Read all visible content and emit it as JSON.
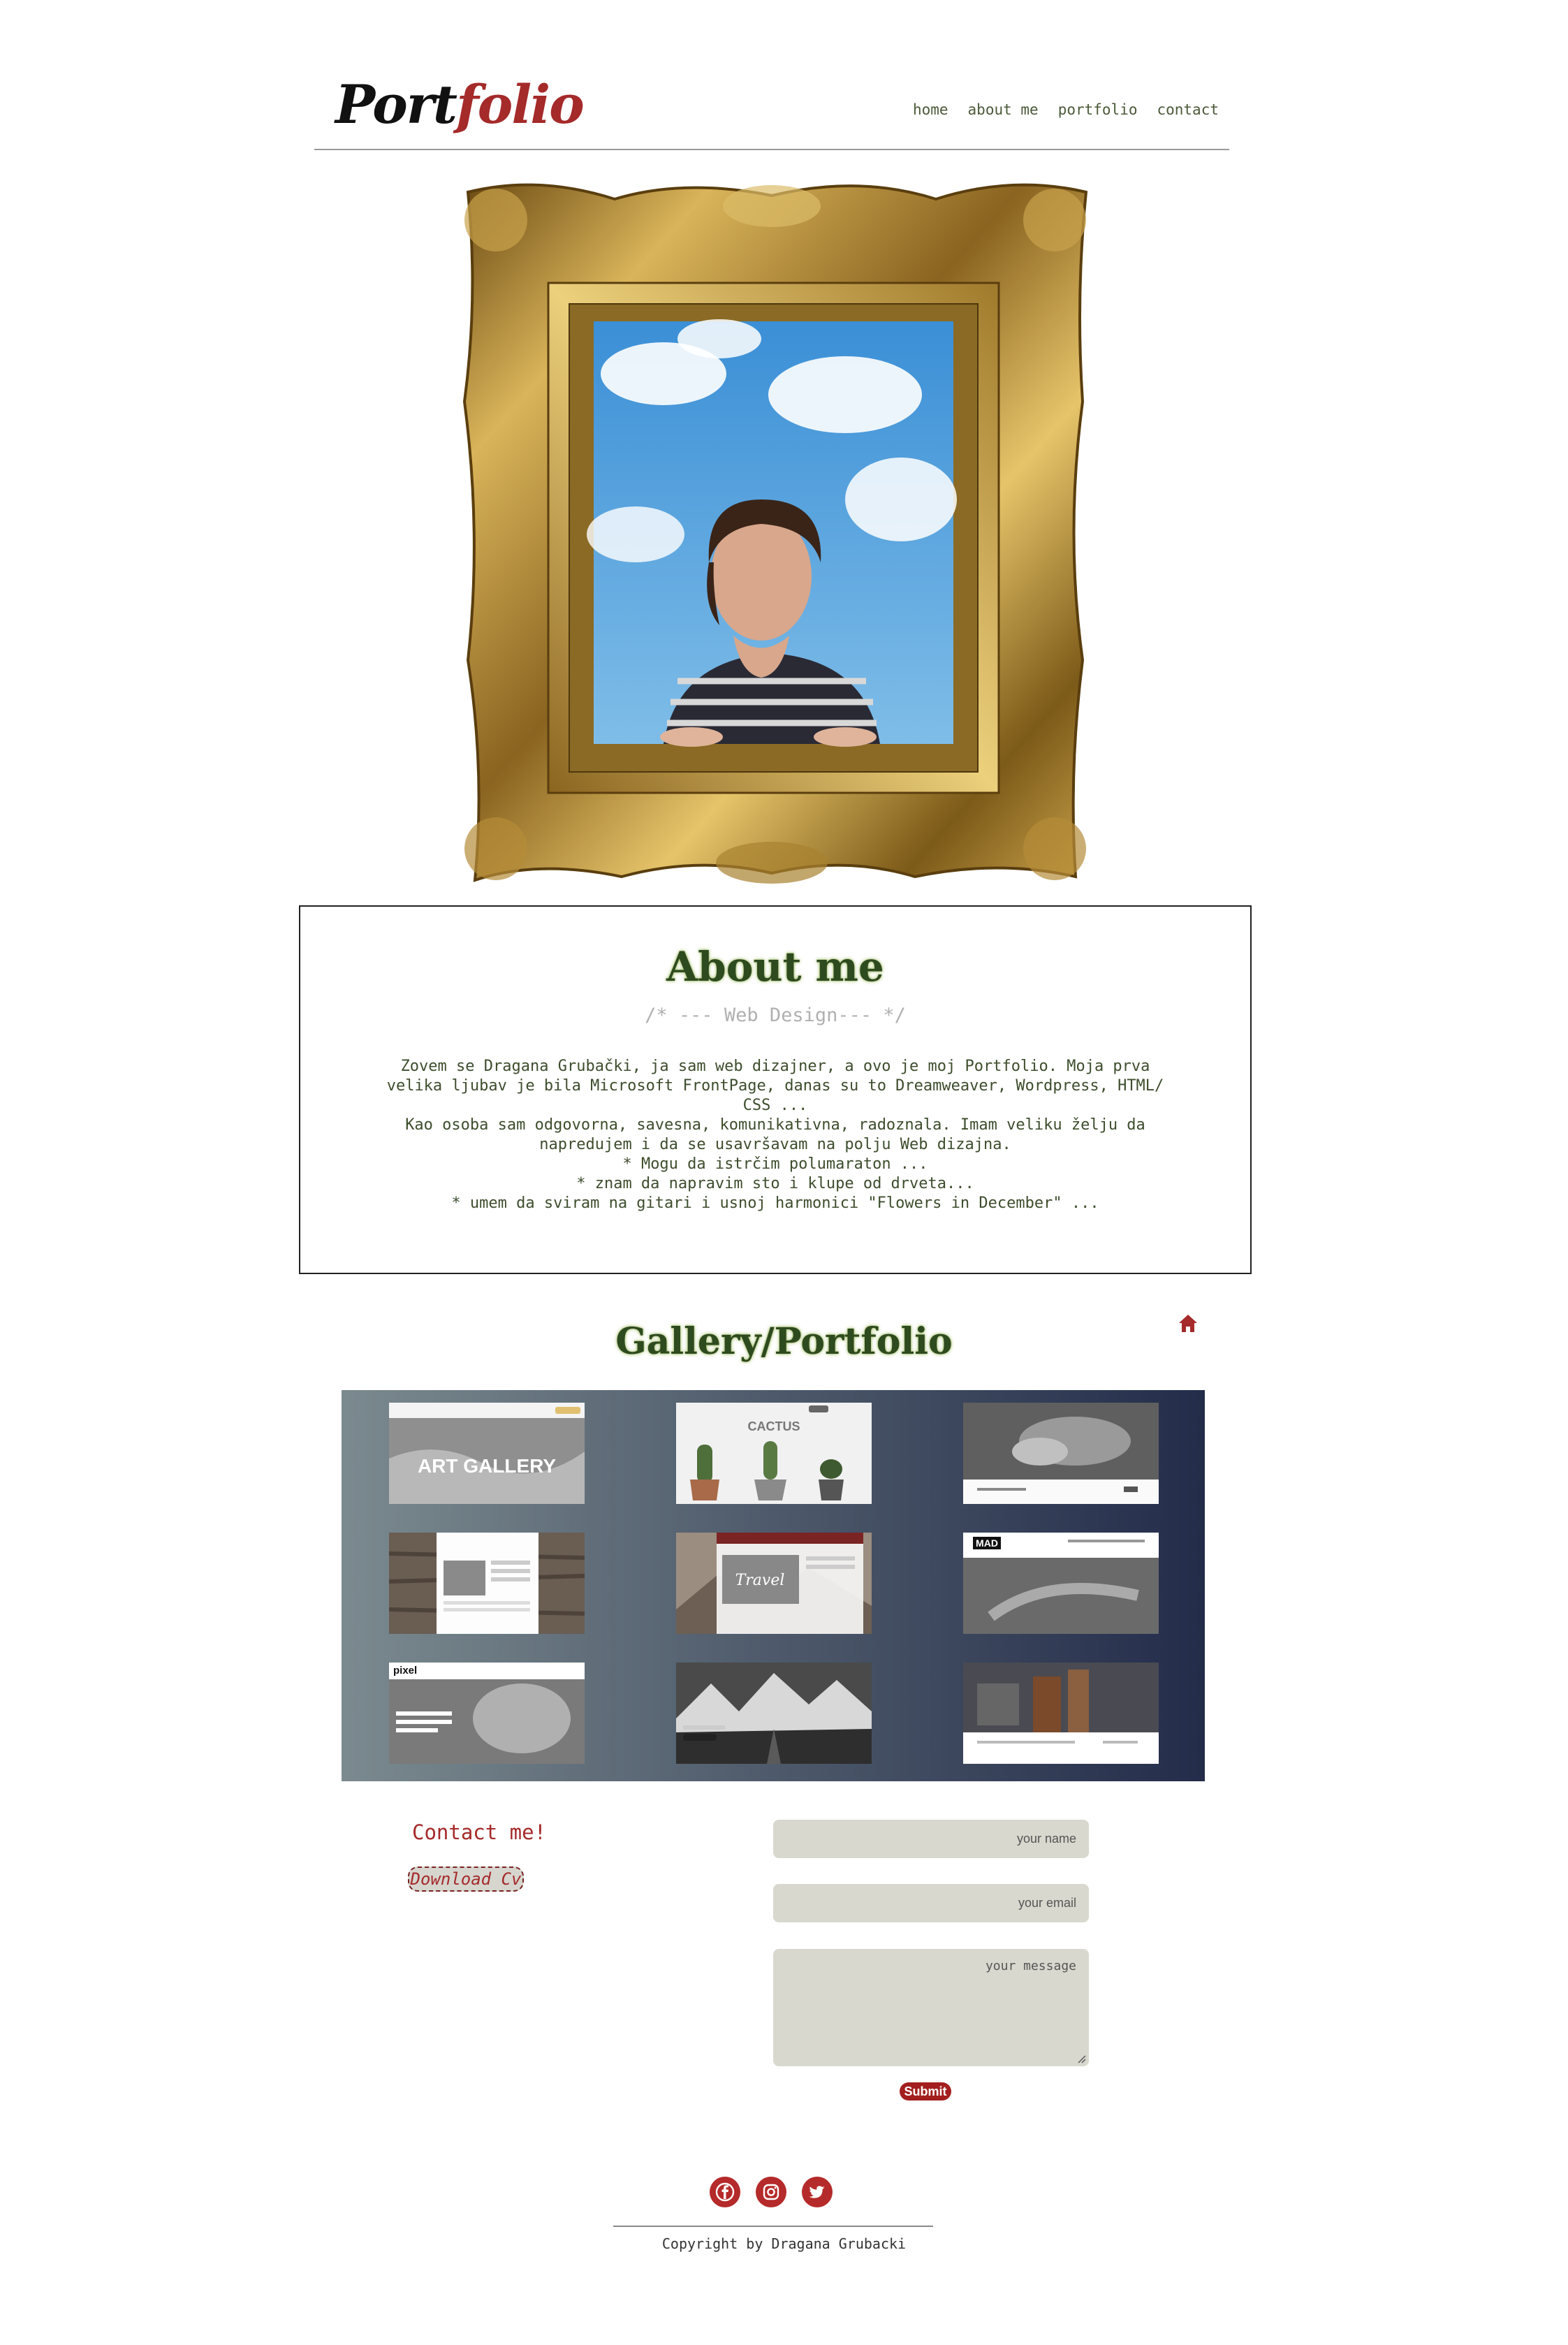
{
  "header": {
    "logo_part1": "Port",
    "logo_part2": "folio",
    "nav": [
      "home",
      "about me",
      "portfolio",
      "contact"
    ]
  },
  "about": {
    "title": "About me",
    "subtitle": "/* --- Web Design--- */",
    "paragraphs": [
      "Zovem se Dragana Grubački, ja sam web dizajner, a ovo je moj Portfolio. Moja prva velika ljubav je bila Microsoft FrontPage, danas su to Dreamweaver, Wordpress, HTML/ CSS ...",
      "Kao osoba sam odgovorna, savesna, komunikativna, radoznala. Imam veliku želju da napredujem i da se usavršavam na polju Web dizajna.",
      "* Mogu da istrčim polumaraton ...",
      "* znam da napravim sto i klupe od drveta...",
      "* umem da sviram na gitari i usnoj harmonici \"Flowers in December\" ..."
    ]
  },
  "gallery": {
    "title": "Gallery/Portfolio",
    "thumb_texts": {
      "art_gallery": "ART GALLERY",
      "cactus": "CACTUS",
      "pixel": "pixel",
      "mad": "MAD",
      "travel": "Travel"
    }
  },
  "contact": {
    "title": "Contact me!",
    "download_label": "Download Cv",
    "name_placeholder": "your name",
    "email_placeholder": "your email",
    "message_placeholder": "your message",
    "submit_label": "Submit"
  },
  "footer": {
    "social": [
      "facebook-icon",
      "instagram-icon",
      "twitter-icon"
    ],
    "copyright": "Copyright by Dragana Grubacki"
  },
  "colors": {
    "accent": "#a52a2a",
    "heading_green": "#2e4a1f",
    "input_bg": "#d8d8cf"
  }
}
